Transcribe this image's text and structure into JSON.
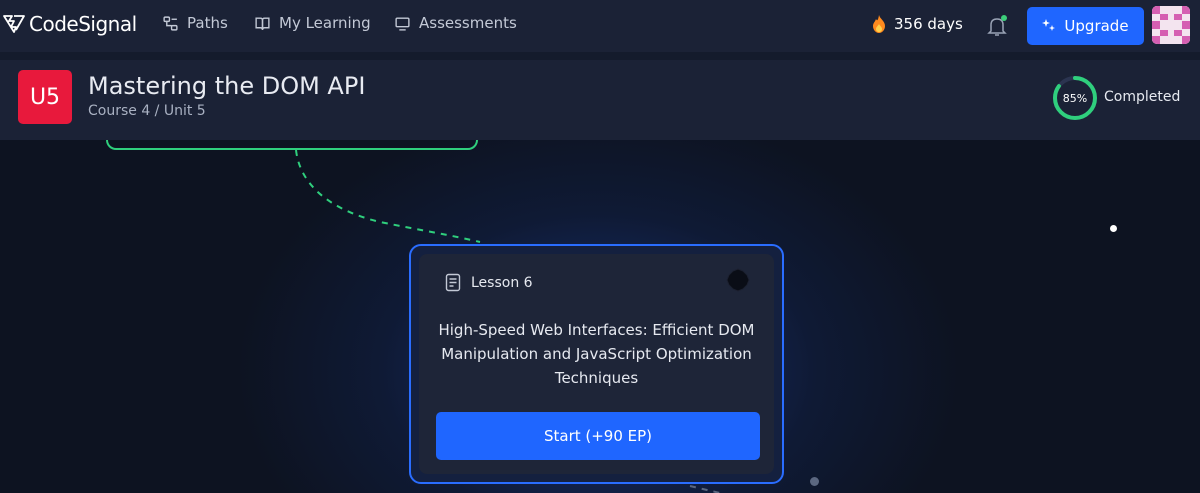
{
  "header": {
    "logo_text": "CodeSignal",
    "nav": [
      {
        "label": "Paths",
        "icon": "paths-icon"
      },
      {
        "label": "My Learning",
        "icon": "book-icon"
      },
      {
        "label": "Assessments",
        "icon": "monitor-icon"
      }
    ],
    "streak": {
      "value": "356 days",
      "icon": "flame-icon"
    },
    "notifications_icon": "bell-icon",
    "upgrade_label": "Upgrade",
    "upgrade_icon": "sparkle-icon"
  },
  "unit": {
    "badge": "U5",
    "title": "Mastering the DOM API",
    "subtitle": "Course 4 / Unit 5",
    "progress_percent": 85,
    "progress_label": "85%",
    "completed_label": "Completed"
  },
  "lesson": {
    "label": "Lesson 6",
    "icon": "document-icon",
    "title": "High-Speed Web Interfaces: Efficient DOM Manipulation and JavaScript Optimization Techniques",
    "start_label": "Start (+90 EP)"
  },
  "colors": {
    "accent_blue": "#1f66ff",
    "unit_red": "#e8193c",
    "complete_green": "#2fcf7d",
    "nav_bg": "#1b2236"
  }
}
